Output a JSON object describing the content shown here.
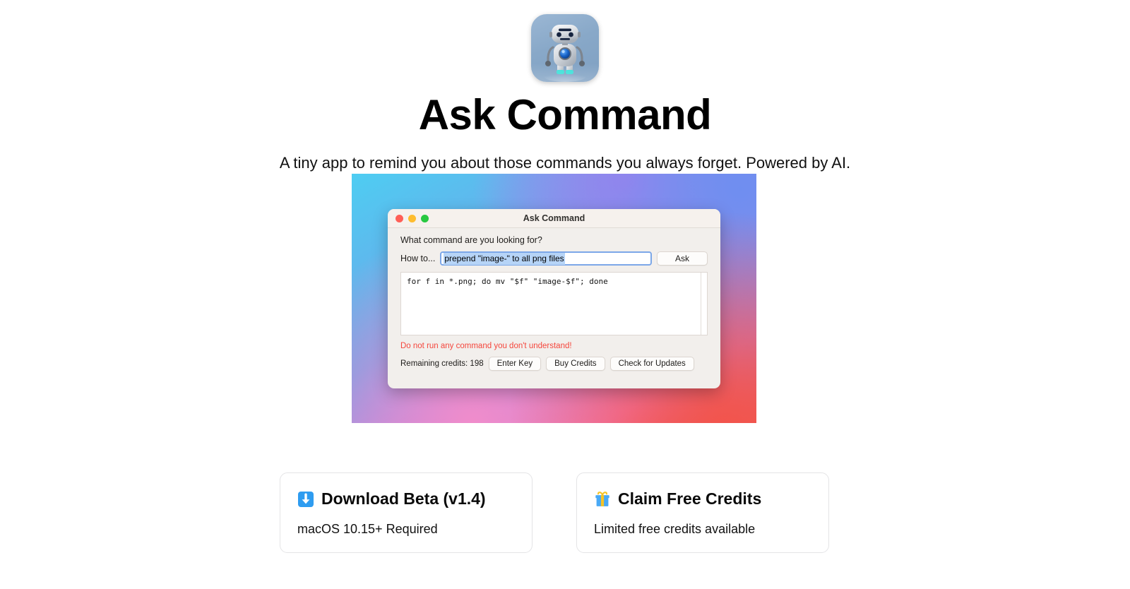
{
  "hero": {
    "icon_name": "robot-app-icon",
    "title": "Ask Command",
    "subtitle": "A tiny app to remind you about those commands you always forget. Powered by AI."
  },
  "screenshot": {
    "window": {
      "title": "Ask Command",
      "traffic_lights": [
        "close-red",
        "minimize-yellow",
        "zoom-green"
      ],
      "prompt_label": "What command are you looking for?",
      "how_to_label": "How to...",
      "query_value": "prepend \"image-\" to all png files",
      "query_placeholder": "prepend \"image-\" to all png files",
      "ask_button": "Ask",
      "result": "for f in *.png; do mv \"$f\" \"image-$f\"; done",
      "warning": "Do not run any command you don't understand!",
      "credits": "Remaining credits: 198",
      "buttons": [
        "Enter Key",
        "Buy Credits",
        "Check for Updates"
      ]
    },
    "background_colors": {
      "top_left": "#4ecdf2",
      "top_right": "#6f8ef0",
      "mid_purple": "#b388e0",
      "bottom_left": "#ef77bb",
      "bottom_right": "#f2594f"
    }
  },
  "cards": [
    {
      "icon": "download-arrow-icon",
      "title": "Download Beta (v1.4)",
      "subtitle": "macOS 10.15+ Required"
    },
    {
      "icon": "gift-icon",
      "title": "Claim Free Credits",
      "subtitle": "Limited free credits available"
    }
  ],
  "colors": {
    "warning_red": "#f5463c",
    "focus_blue": "#7ca7e8",
    "selection_blue": "#b6d4f7",
    "download_blue": "#2e9cf0",
    "gift_blue": "#49a9f5",
    "gift_ribbon": "#f7c325"
  }
}
